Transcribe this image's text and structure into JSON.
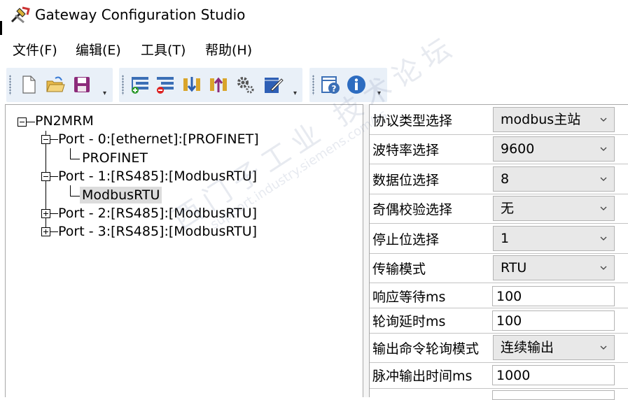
{
  "window": {
    "title": "Gateway Configuration Studio"
  },
  "menu": [
    "文件(F)",
    "编辑(E)",
    "工具(T)",
    "帮助(H)"
  ],
  "toolbar": {
    "groups": [
      [
        "new-file-icon",
        "open-folder-icon",
        "save-icon"
      ],
      [
        "add-port-icon",
        "remove-port-icon",
        "download-icon",
        "upload-icon",
        "settings-gear-icon",
        "edit-notes-icon"
      ],
      [
        "help-icon",
        "info-icon"
      ]
    ]
  },
  "tree": {
    "root": "PN2MRM",
    "ports": [
      {
        "label": "Port - 0:[ethernet]:[PROFINET]",
        "expanded": true,
        "child": "PROFINET"
      },
      {
        "label": "Port - 1:[RS485]:[ModbusRTU]",
        "expanded": true,
        "child": "ModbusRTU"
      },
      {
        "label": "Port - 2:[RS485]:[ModbusRTU]",
        "expanded": false
      },
      {
        "label": "Port - 3:[RS485]:[ModbusRTU]",
        "expanded": false
      }
    ],
    "selected": "ModbusRTU"
  },
  "properties": [
    {
      "label": "协议类型选择",
      "value": "modbus主站",
      "type": "combo"
    },
    {
      "label": "波特率选择",
      "value": "9600",
      "type": "combo"
    },
    {
      "label": "数据位选择",
      "value": "8",
      "type": "combo"
    },
    {
      "label": "奇偶校验选择",
      "value": "无",
      "type": "combo"
    },
    {
      "label": "停止位选择",
      "value": "1",
      "type": "combo"
    },
    {
      "label": "传输模式",
      "value": "RTU",
      "type": "combo"
    },
    {
      "label": "响应等待ms",
      "value": "100",
      "type": "text"
    },
    {
      "label": "轮询延时ms",
      "value": "100",
      "type": "text"
    },
    {
      "label": "输出命令轮询模式",
      "value": "连续输出",
      "type": "combo"
    },
    {
      "label": "脉冲输出时间ms",
      "value": "1000",
      "type": "text"
    }
  ],
  "watermark": {
    "line1": "西门子工业  技术论坛",
    "line2": "support.industry.siemens.com/cs"
  },
  "colors": {
    "toolbar_bg": "#e9f0f8",
    "combo_bg": "#e8e8e8",
    "selection": "#dcdcdc"
  }
}
